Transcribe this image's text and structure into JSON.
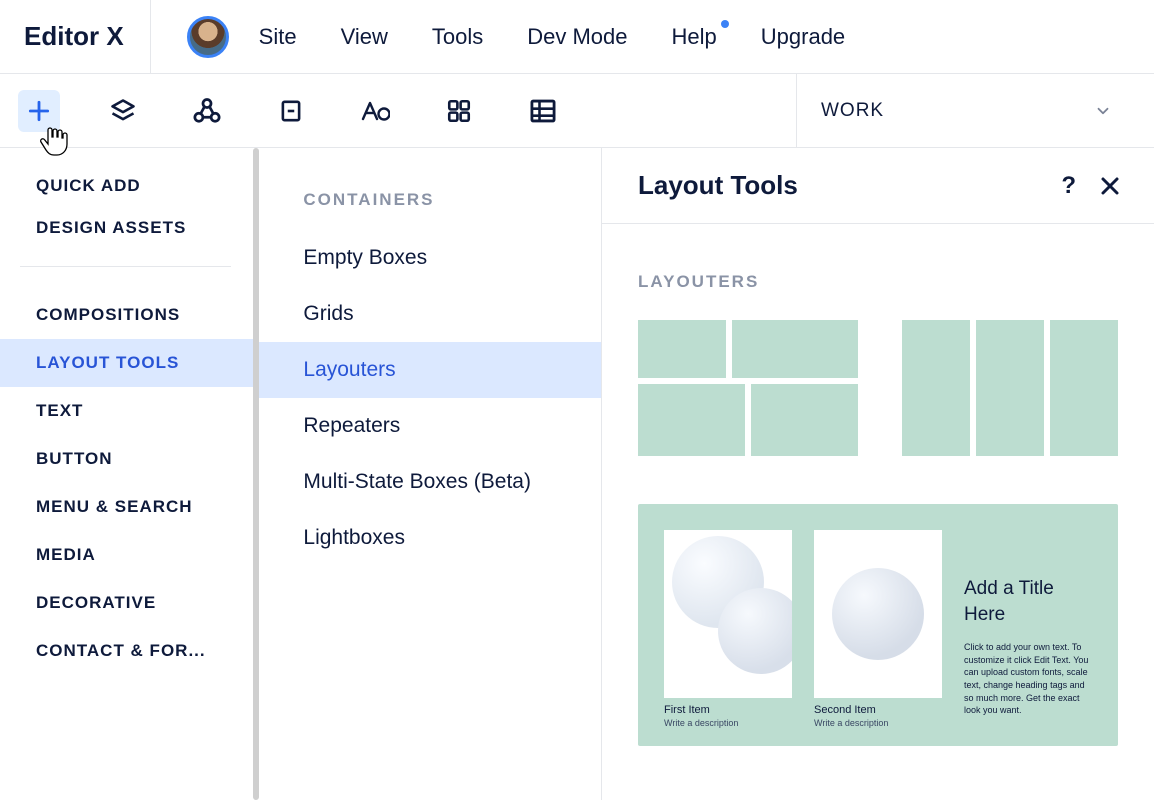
{
  "brand": "Editor X",
  "menu": [
    "Site",
    "View",
    "Tools",
    "Dev Mode",
    "Help",
    "Upgrade"
  ],
  "menu_notify_index": 4,
  "page_select": "WORK",
  "left": {
    "quick_add": "QUICK ADD",
    "design_assets": "DESIGN ASSETS",
    "categories": [
      "COMPOSITIONS",
      "LAYOUT TOOLS",
      "TEXT",
      "BUTTON",
      "MENU & SEARCH",
      "MEDIA",
      "DECORATIVE",
      "CONTACT & FOR..."
    ],
    "active_category_index": 1
  },
  "mid": {
    "header": "CONTAINERS",
    "items": [
      "Empty Boxes",
      "Grids",
      "Layouters",
      "Repeaters",
      "Multi-State Boxes (Beta)",
      "Lightboxes"
    ],
    "active_index": 2
  },
  "right": {
    "title": "Layout Tools",
    "sub": "LAYOUTERS",
    "sample": {
      "item1_title": "First Item",
      "item1_desc": "Write a description",
      "item2_title": "Second Item",
      "item2_desc": "Write a description",
      "add_title_line1": "Add a Title",
      "add_title_line2": "Here",
      "para": "Click to add your own text. To customize it click Edit Text. You can upload custom fonts, scale text, change heading tags and so much more. Get the exact look you want."
    }
  }
}
